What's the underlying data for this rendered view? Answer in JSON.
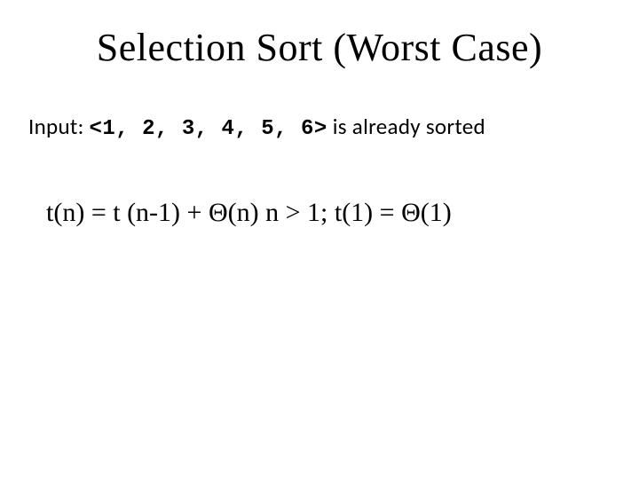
{
  "title": "Selection Sort (Worst Case)",
  "input_label": "Input:",
  "input_sequence": "<1, 2, 3, 4, 5, 6>",
  "input_suffix": "is already sorted",
  "recurrence": "t(n) = t (n-1) + Θ(n) n > 1; t(1) = Θ(1)"
}
